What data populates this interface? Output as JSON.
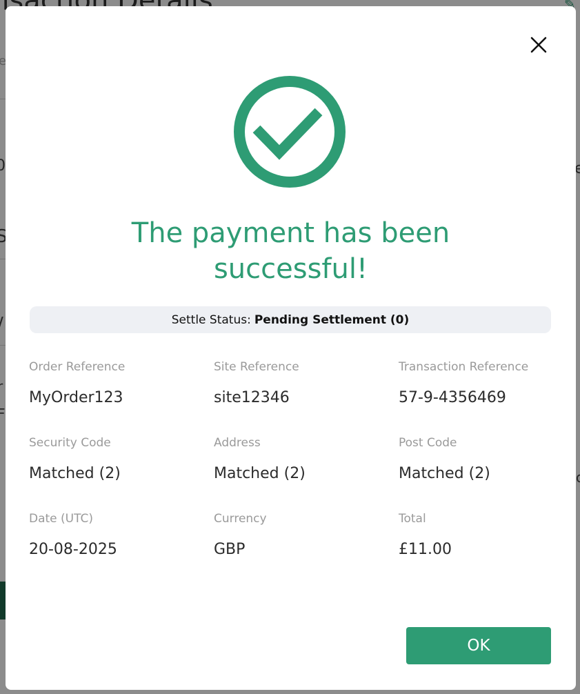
{
  "background": {
    "title": "nsaction Details",
    "fragments": [
      "e",
      "0",
      "e",
      "S",
      "/",
      "r",
      "F",
      "o"
    ]
  },
  "modal": {
    "close_icon": "close-icon",
    "success_icon": "check-circle-icon",
    "headline_line1": "The payment has been",
    "headline_line2": "successful!",
    "settle_status": {
      "label": "Settle Status:",
      "value": "Pending Settlement (0)"
    },
    "fields": [
      {
        "label": "Order Reference",
        "value": "MyOrder123"
      },
      {
        "label": "Site Reference",
        "value": "site12346"
      },
      {
        "label": "Transaction Reference",
        "value": "57-9-4356469"
      },
      {
        "label": "Security Code",
        "value": "Matched (2)"
      },
      {
        "label": "Address",
        "value": "Matched (2)"
      },
      {
        "label": "Post Code",
        "value": "Matched (2)"
      },
      {
        "label": "Date (UTC)",
        "value": "20-08-2025"
      },
      {
        "label": "Currency",
        "value": "GBP"
      },
      {
        "label": "Total",
        "value": "£11.00"
      }
    ],
    "ok_label": "OK"
  },
  "colors": {
    "accent": "#2e9c74",
    "status_bg": "#eef0f4",
    "label_gray": "#9a9a9a"
  }
}
